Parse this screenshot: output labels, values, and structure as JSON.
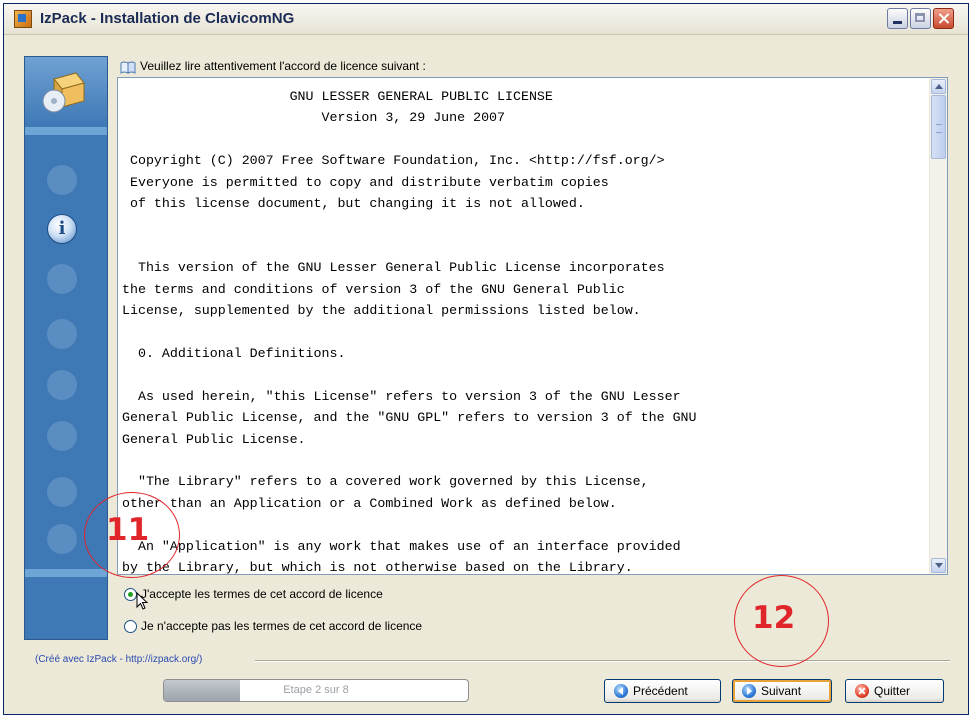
{
  "window": {
    "title": "IzPack - Installation de ClavicomNG"
  },
  "sidebar": {
    "steps": [
      "home-icon",
      "info-icon",
      "user-icon",
      "packs-icon",
      "options-icon",
      "install-icon",
      "shortcuts-icon",
      "finish-icon"
    ],
    "current_step": 2
  },
  "license": {
    "prompt": "Veuillez lire attentivement l'accord de licence suivant :",
    "text": "                     GNU LESSER GENERAL PUBLIC LICENSE\n                         Version 3, 29 June 2007\n\n Copyright (C) 2007 Free Software Foundation, Inc. <http://fsf.org/>\n Everyone is permitted to copy and distribute verbatim copies\n of this license document, but changing it is not allowed.\n\n\n  This version of the GNU Lesser General Public License incorporates\nthe terms and conditions of version 3 of the GNU General Public\nLicense, supplemented by the additional permissions listed below.\n\n  0. Additional Definitions.\n\n  As used herein, \"this License\" refers to version 3 of the GNU Lesser\nGeneral Public License, and the \"GNU GPL\" refers to version 3 of the GNU\nGeneral Public License.\n\n  \"The Library\" refers to a covered work governed by this License,\nother than an Application or a Combined Work as defined below.\n\n  An \"Application\" is any work that makes use of an interface provided\nby the Library, but which is not otherwise based on the Library."
  },
  "options": {
    "accept": "J'accepte les termes de cet accord de licence",
    "decline": "Je n'accepte pas les termes de cet accord de licence",
    "selected": "accept"
  },
  "footer": {
    "credit": "(Créé avec IzPack - http://izpack.org/)",
    "progress_text": "Etape 2 sur 8",
    "progress_fraction": 0.25,
    "prev_label": "Précédent",
    "next_label": "Suivant",
    "quit_label": "Quitter"
  },
  "annotations": {
    "callout_1": "11",
    "callout_2": "12",
    "color": "#e0262a"
  }
}
